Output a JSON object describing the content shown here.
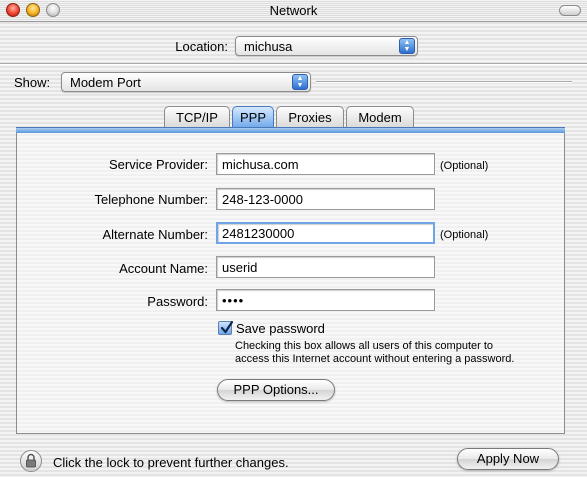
{
  "window": {
    "title": "Network"
  },
  "location": {
    "label": "Location:",
    "value": "michusa"
  },
  "show": {
    "label": "Show:",
    "value": "Modem Port"
  },
  "tabs": [
    {
      "label": "TCP/IP",
      "selected": false
    },
    {
      "label": "PPP",
      "selected": true
    },
    {
      "label": "Proxies",
      "selected": false
    },
    {
      "label": "Modem",
      "selected": false
    }
  ],
  "form": {
    "service_provider": {
      "label": "Service Provider:",
      "value": "michusa.com",
      "note": "(Optional)"
    },
    "telephone_number": {
      "label": "Telephone Number:",
      "value": "248-123-0000"
    },
    "alternate_number": {
      "label": "Alternate Number:",
      "value": "2481230000",
      "note": "(Optional)"
    },
    "account_name": {
      "label": "Account Name:",
      "value": "userid"
    },
    "password": {
      "label": "Password:",
      "value": "••••"
    }
  },
  "save_password": {
    "label": "Save password",
    "checked": true,
    "help_line1": "Checking this box allows all users of this computer to",
    "help_line2": "access this Internet account without entering a password."
  },
  "ppp_options_button": "PPP Options...",
  "footer": {
    "lock_text": "Click the lock to prevent further changes.",
    "apply_button": "Apply Now"
  },
  "icons": [
    "close-light",
    "minimize-light",
    "zoom-light",
    "popup-arrows-icon",
    "checkmark-icon",
    "lock-icon"
  ],
  "colors": {
    "accent": "#3a7bd5",
    "focus_ring": "#6fa5e6"
  }
}
